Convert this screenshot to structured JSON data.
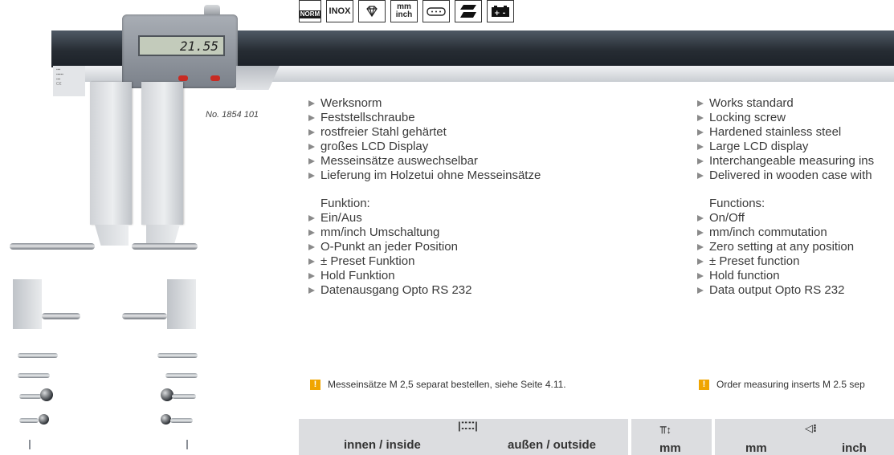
{
  "icons": [
    {
      "name": "norm-icon",
      "label": "NORM"
    },
    {
      "name": "inox-icon",
      "label": "INOX"
    },
    {
      "name": "diamond-icon",
      "label": ""
    },
    {
      "name": "mm-inch-icon",
      "label": "mm\ninch"
    },
    {
      "name": "data-output-icon",
      "label": ""
    },
    {
      "name": "display-icon",
      "label": ""
    },
    {
      "name": "battery-icon",
      "label": "+ -"
    }
  ],
  "caliper": {
    "lcd_value": "21.55",
    "model_number": "No. 1854 101"
  },
  "german": {
    "features": [
      "Werksnorm",
      "Feststellschraube",
      "rostfreier Stahl gehärtet",
      "großes LCD Display",
      "Messeinsätze auswechselbar",
      "Lieferung im Holzetui ohne Messeinsätze"
    ],
    "functions_title": "Funktion:",
    "functions": [
      "Ein/Aus",
      "mm/inch Umschaltung",
      "O-Punkt an jeder Position",
      "± Preset Funktion",
      "Hold Funktion",
      "Datenausgang Opto RS 232"
    ],
    "note": "Messeinsätze M 2,5 separat bestellen, siehe Seite 4.11."
  },
  "english": {
    "features": [
      "Works standard",
      "Locking screw",
      "Hardened stainless steel",
      "Large LCD display",
      "Interchangeable measuring ins",
      "Delivered in wooden case with"
    ],
    "functions_title": "Functions:",
    "functions": [
      "On/Off",
      "mm/inch commutation",
      "Zero setting at any position",
      "± Preset function",
      "Hold function",
      "Data output Opto RS 232"
    ],
    "note": "Order measuring inserts M 2.5 sep"
  },
  "table": {
    "inside_label": "innen / inside",
    "outside_label": "außen / outside",
    "col2_unit": "mm",
    "col3_unit_mm": "mm",
    "col3_unit_inch": "inch"
  },
  "colors": {
    "note_accent": "#f0a500",
    "beam": "#262c33",
    "header_bg": "#dcdde0"
  }
}
